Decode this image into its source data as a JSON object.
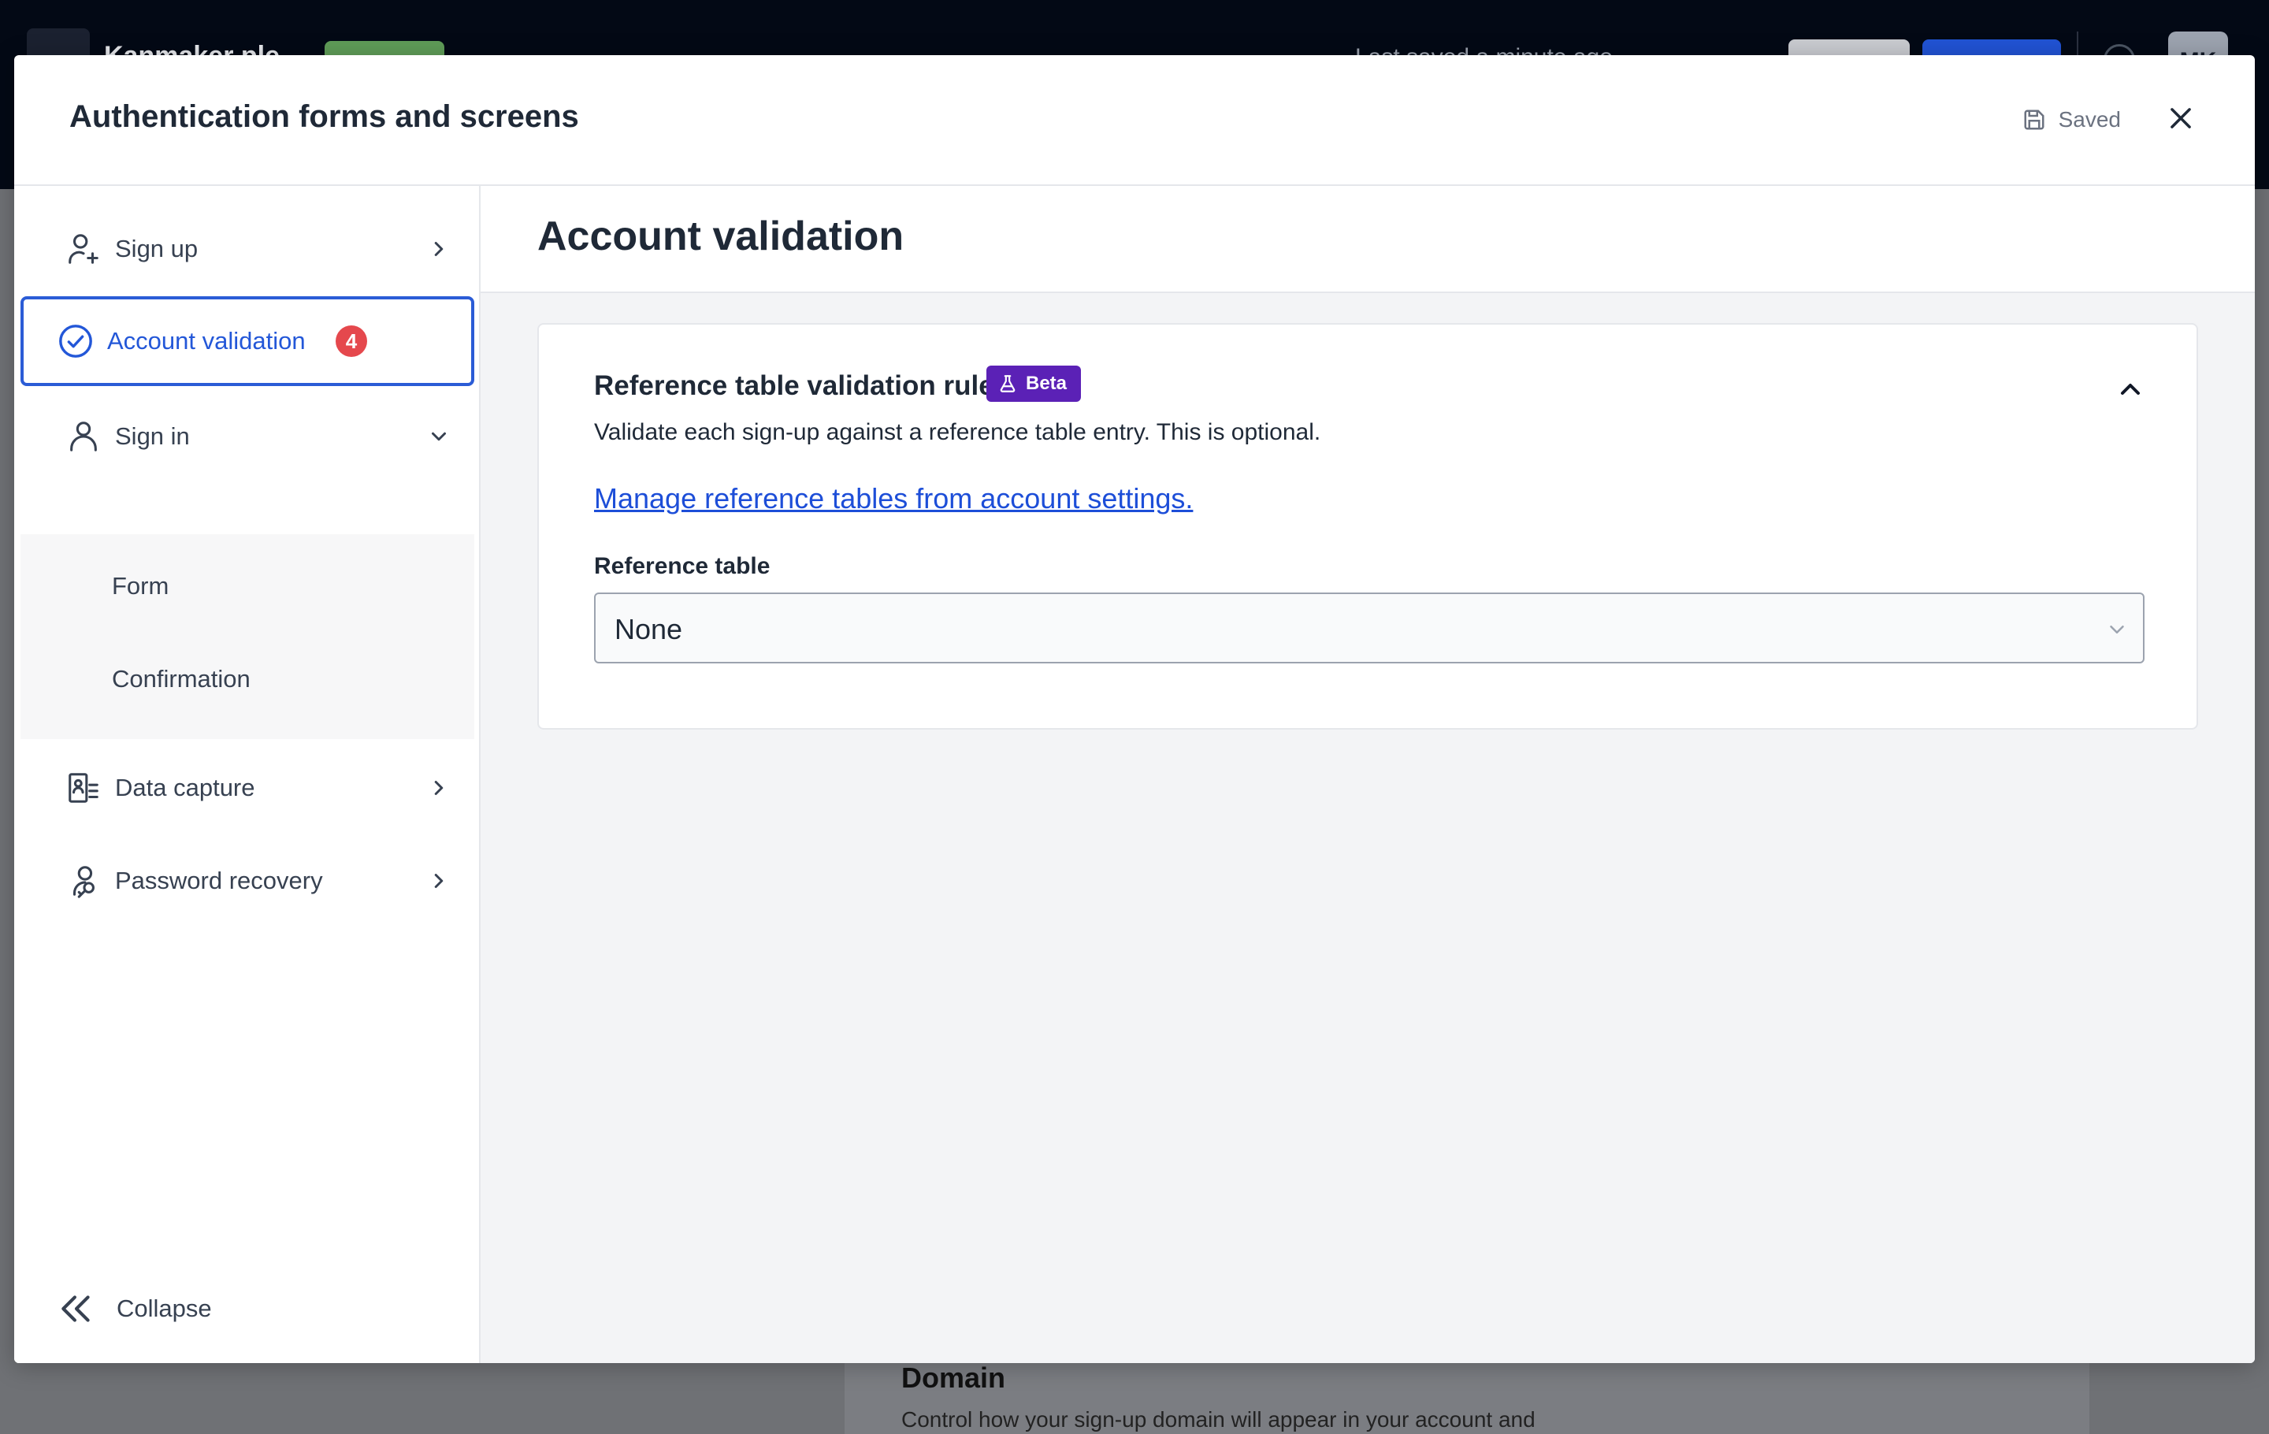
{
  "background": {
    "app_name": "Kanmaker ple",
    "status_text": "Last saved a minute ago",
    "avatar_initials": "MK",
    "domain_heading": "Domain",
    "domain_description": "Control how your sign-up domain will appear in your account and"
  },
  "modal": {
    "title": "Authentication forms and screens",
    "saved_label": "Saved"
  },
  "sidebar": {
    "items": [
      {
        "label": "Sign up",
        "icon": "user-plus-icon"
      },
      {
        "label": "Account validation",
        "icon": "check-circle-icon",
        "badge": "4",
        "active": true
      },
      {
        "label": "Sign in",
        "icon": "user-icon",
        "expanded": true
      },
      {
        "label": "Data capture",
        "icon": "form-icon"
      },
      {
        "label": "Password recovery",
        "icon": "key-user-icon"
      }
    ],
    "sign_in_sub": [
      "Form",
      "Confirmation"
    ],
    "collapse_label": "Collapse"
  },
  "main": {
    "title": "Account validation",
    "card": {
      "title": "Reference table validation rules",
      "beta_label": "Beta",
      "description": "Validate each sign-up against a reference table entry. This is optional.",
      "link_text": "Manage reference tables from account settings.",
      "field_label": "Reference table",
      "select_value": "None"
    }
  },
  "colors": {
    "accent": "#2b5cd6",
    "badge": "#e5484d",
    "beta": "#5b21b6",
    "link": "#1d4ed8"
  }
}
